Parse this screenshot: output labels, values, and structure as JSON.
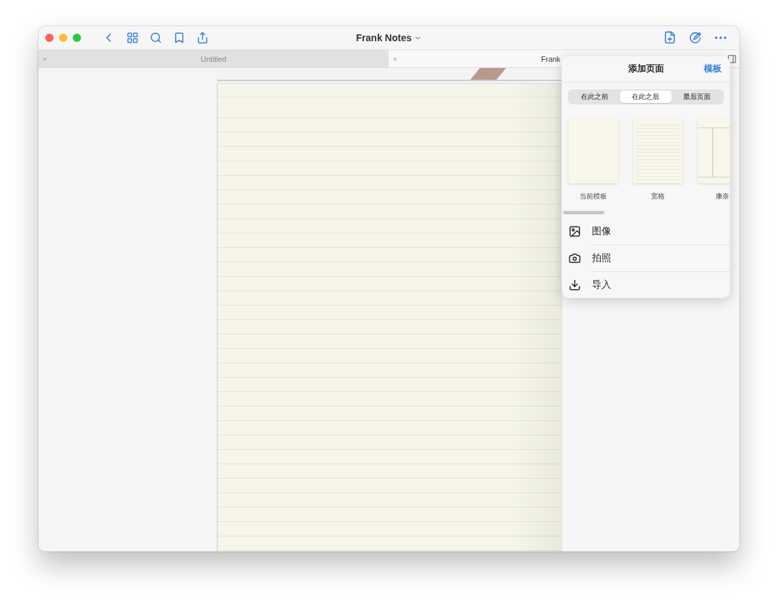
{
  "window": {
    "title": "Frank Notes"
  },
  "tabs": [
    {
      "label": "Untitled",
      "close": "×",
      "selected": false
    },
    {
      "label": "Frank",
      "close": "×",
      "selected": true
    }
  ],
  "popover": {
    "title": "添加页面",
    "action": "模板",
    "segments": [
      {
        "label": "在此之前",
        "selected": false
      },
      {
        "label": "在此之后",
        "selected": true
      },
      {
        "label": "最后页面",
        "selected": false
      }
    ],
    "templates": [
      {
        "label": "当前模板",
        "kind": "blank"
      },
      {
        "label": "宽格",
        "kind": "ruled"
      },
      {
        "label": "康奈",
        "kind": "cornell"
      }
    ],
    "items": [
      {
        "label": "图像",
        "kind": "image"
      },
      {
        "label": "拍照",
        "kind": "camera"
      },
      {
        "label": "导入",
        "kind": "import"
      }
    ]
  }
}
